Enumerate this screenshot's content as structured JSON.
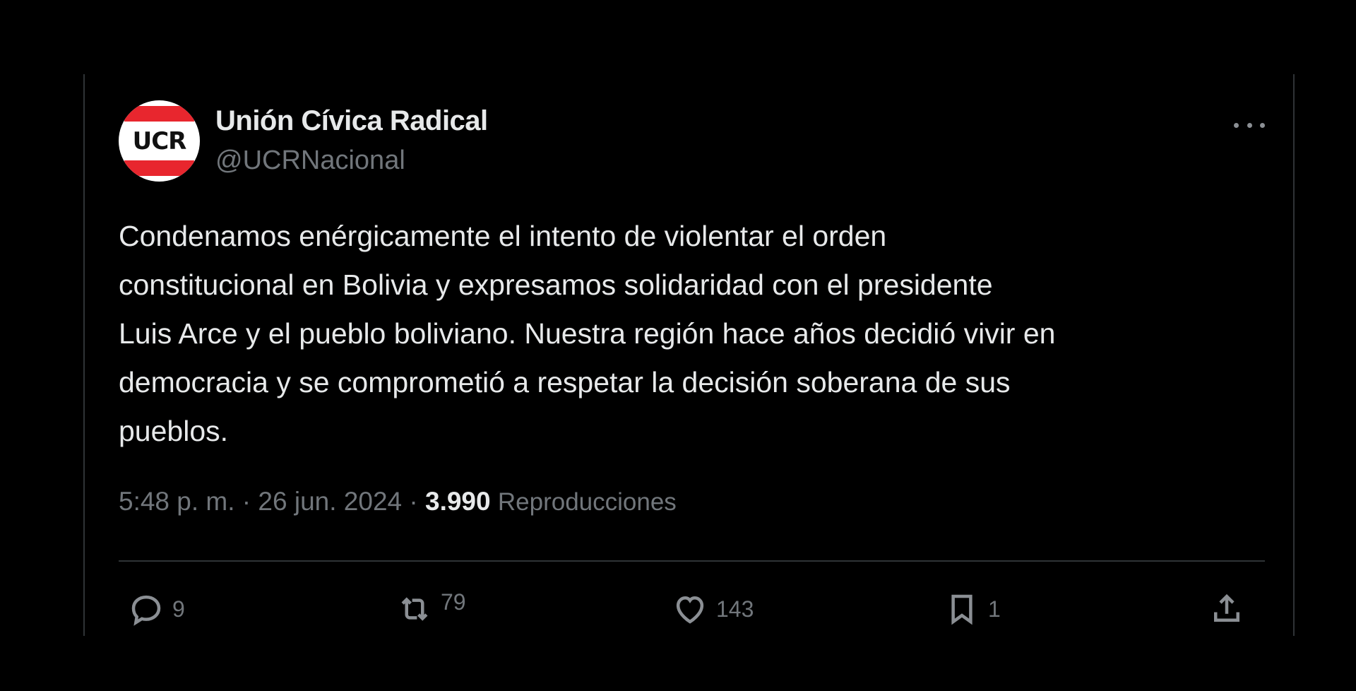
{
  "account": {
    "display_name": "Unión Cívica Radical",
    "handle": "@UCRNacional",
    "avatar_text": "UCR"
  },
  "tweet": {
    "text": "Condenamos enérgicamente el intento de violentar el orden\nconstitucional en Bolivia y expresamos solidaridad con el presidente\nLuis Arce y el pueblo boliviano. Nuestra región hace años decidió vivir en\ndemocracia y se comprometió a respetar la decisión soberana de sus\npueblos.",
    "time": "5:48 p. m.",
    "separator": " · ",
    "date": "26 jun. 2024",
    "views_count": "3.990",
    "views_label": "Reproducciones"
  },
  "actions": {
    "replies": "9",
    "retweets": "79",
    "likes": "143",
    "bookmarks": "1"
  },
  "icons": {
    "more": "more-horizontal-icon",
    "reply": "reply-icon",
    "retweet": "retweet-icon",
    "like": "heart-icon",
    "bookmark": "bookmark-icon",
    "share": "share-icon"
  },
  "colors": {
    "background": "#000000",
    "text_primary": "#e7e9ea",
    "text_secondary": "#71767b",
    "border": "#2f3336",
    "brand_red": "#e8262e"
  }
}
